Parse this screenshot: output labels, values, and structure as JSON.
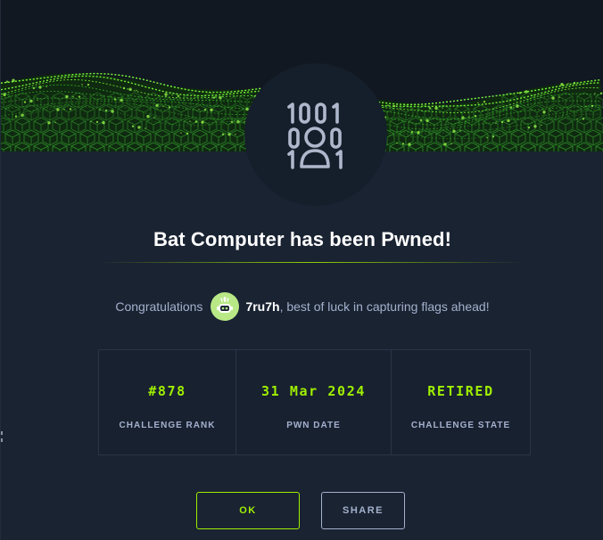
{
  "modal": {
    "title": "Bat Computer has been Pwned!",
    "congrats_prefix": "Congratulations",
    "username": "7ru7h",
    "congrats_suffix": ", best of luck in capturing flags ahead!",
    "badge_icon": "binary-user-icon",
    "user_avatar_icon": "robot-avatar-icon"
  },
  "stats": [
    {
      "value": "#878",
      "label": "CHALLENGE RANK"
    },
    {
      "value": "31 Mar 2024",
      "label": "PWN DATE"
    },
    {
      "value": "RETIRED",
      "label": "CHALLENGE STATE"
    }
  ],
  "buttons": {
    "ok": "OK",
    "share": "SHARE"
  },
  "colors": {
    "accent": "#9fef00",
    "background": "#1a2332",
    "muted_text": "#a4b1cd"
  }
}
